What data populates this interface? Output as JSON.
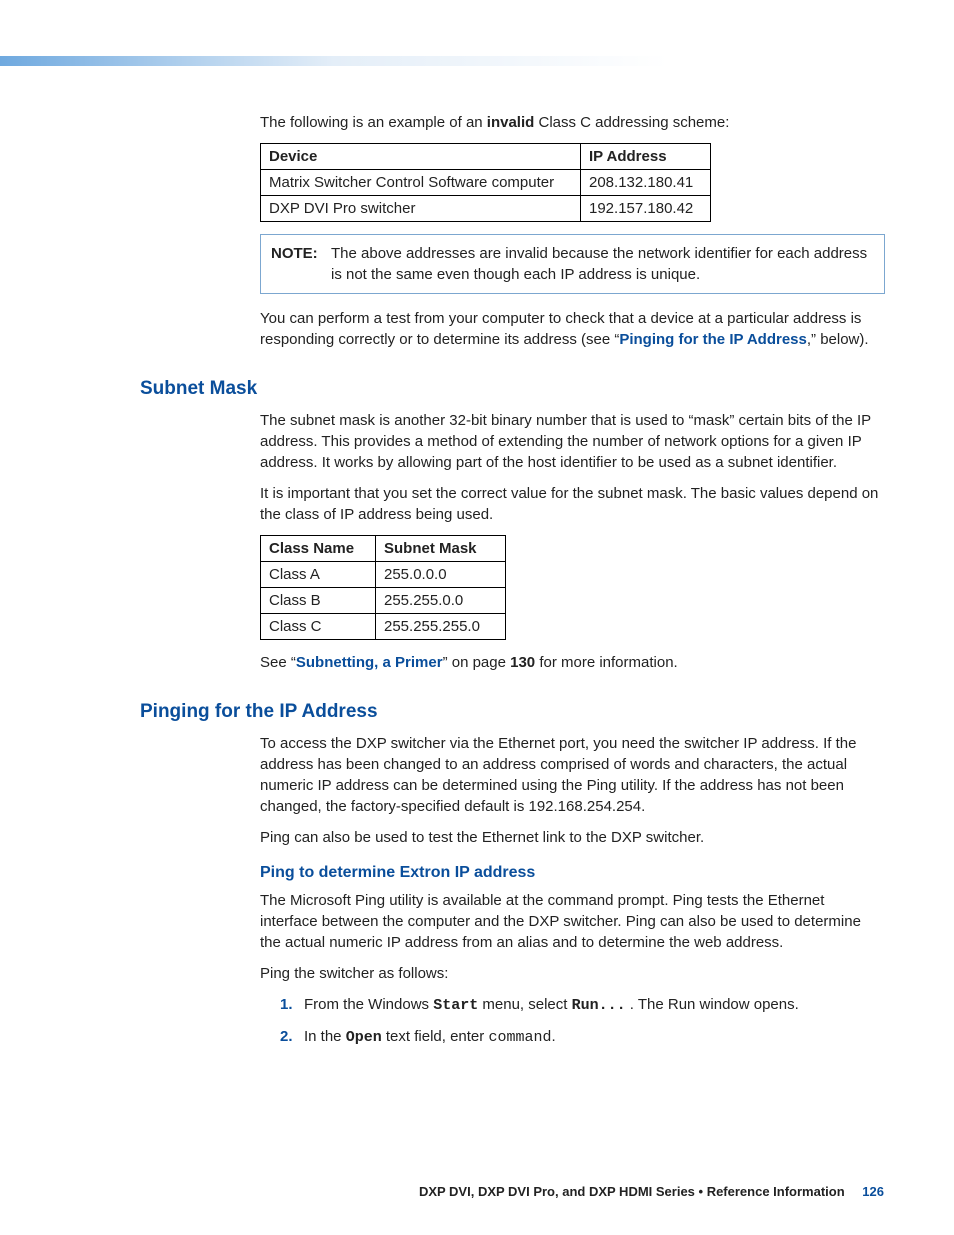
{
  "intro_text_before": "The following is an example of an ",
  "intro_invalid": "invalid",
  "intro_text_after": " Class C addressing scheme:",
  "device_table": {
    "headers": [
      "Device",
      "IP Address"
    ],
    "rows": [
      [
        "Matrix Switcher Control Software computer",
        "208.132.180.41"
      ],
      [
        "DXP DVI Pro switcher",
        "192.157.180.42"
      ]
    ]
  },
  "note": {
    "label": "NOTE:",
    "text": "The above addresses are invalid because the network identifier for each address is not the same even though each IP address is unique."
  },
  "test_paragraph_before": "You can perform a test from your computer to check that a device at a particular address is responding correctly or to determine its address (see “",
  "test_paragraph_link": "Pinging for the IP Address",
  "test_paragraph_after": ",” below).",
  "subnet": {
    "heading": "Subnet Mask",
    "p1": "The subnet mask is another 32-bit binary number that is used to “mask” certain bits of the IP address. This provides a method of extending the number of network options for a given IP address. It works by allowing part of the host identifier to be used as a subnet identifier.",
    "p2": "It is important that you set the correct value for the subnet mask. The basic values depend on the class of IP address being used.",
    "table": {
      "headers": [
        "Class Name",
        "Subnet Mask"
      ],
      "rows": [
        [
          "Class A",
          "255.0.0.0"
        ],
        [
          "Class B",
          "255.255.0.0"
        ],
        [
          "Class C",
          "255.255.255.0"
        ]
      ]
    },
    "see_before": "See “",
    "see_link": "Subnetting, a Primer",
    "see_mid": "” on page ",
    "see_page": "130",
    "see_after": " for more information."
  },
  "pinging": {
    "heading": "Pinging for the IP Address",
    "p1": "To access the DXP switcher via the Ethernet port, you need the switcher IP address. If the address has been changed to an address comprised of words and characters, the actual numeric IP address can be determined using the Ping utility. If the address has not been changed, the factory-specified default is 192.168.254.254.",
    "p2": "Ping can also be used to test the Ethernet link to the DXP switcher.",
    "sub_heading": "Ping to determine Extron IP address",
    "p3": "The Microsoft Ping utility is available at the command prompt. Ping tests the Ethernet interface between the computer and the DXP switcher. Ping can also be used to determine the actual numeric IP address from an alias and to determine the web address.",
    "p4": "Ping the switcher as follows:",
    "steps": {
      "s1_a": "From the Windows ",
      "s1_start": "Start",
      "s1_b": " menu, select ",
      "s1_run": "Run...",
      "s1_c": " . The Run window opens.",
      "s2_a": "In the ",
      "s2_open": "Open",
      "s2_b": " text field, enter ",
      "s2_command": "command",
      "s2_c": "."
    }
  },
  "footer": {
    "title": "DXP DVI, DXP DVI Pro, and DXP HDMI Series • Reference Information",
    "page": "126"
  }
}
